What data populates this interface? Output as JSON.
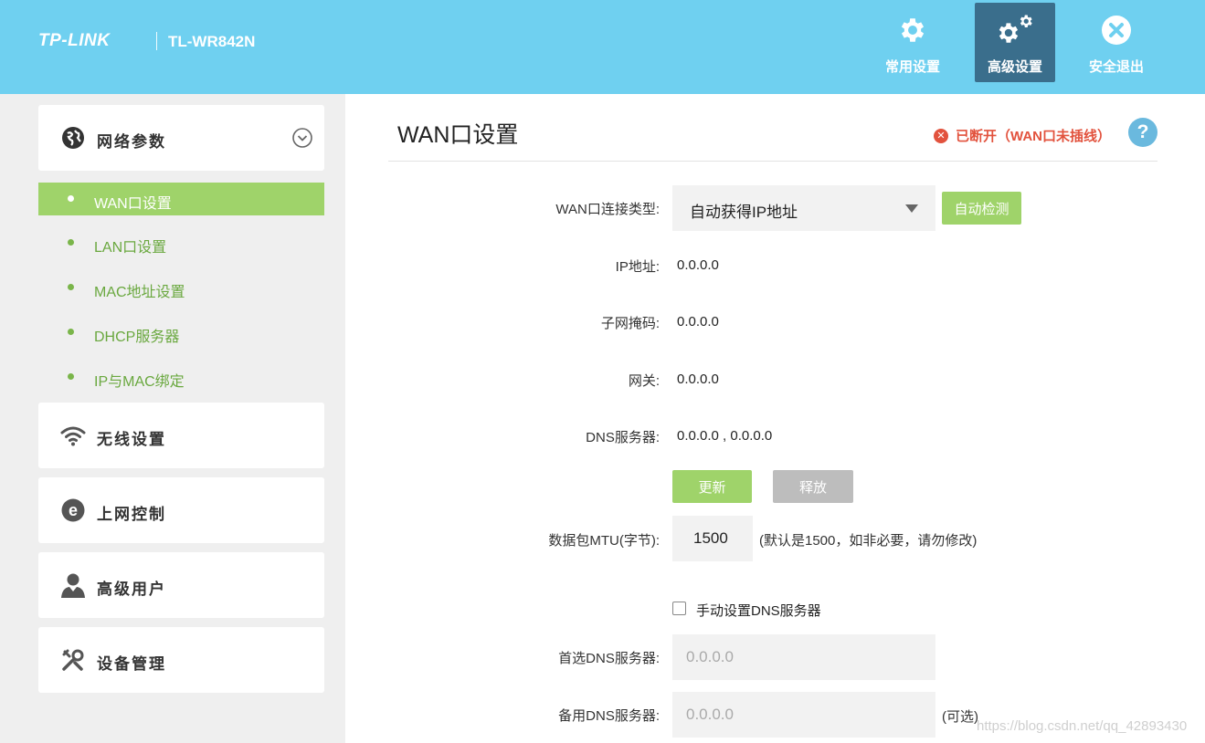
{
  "header": {
    "brand": "TP-LINK",
    "model": "TL-WR842N",
    "nav": [
      {
        "label": "常用设置",
        "icon": "gear-icon",
        "active": false
      },
      {
        "label": "高级设置",
        "icon": "gears-icon",
        "active": true
      },
      {
        "label": "安全退出",
        "icon": "close-icon",
        "active": false
      }
    ]
  },
  "sidebar": {
    "sections": [
      {
        "label": "网络参数",
        "icon": "globe-icon"
      },
      {
        "label": "无线设置",
        "icon": "wifi-icon"
      },
      {
        "label": "上网控制",
        "icon": "internet-e-icon"
      },
      {
        "label": "高级用户",
        "icon": "user-icon"
      },
      {
        "label": "设备管理",
        "icon": "tools-icon"
      }
    ],
    "subitems": [
      {
        "label": "WAN口设置",
        "active": true
      },
      {
        "label": "LAN口设置",
        "active": false
      },
      {
        "label": "MAC地址设置",
        "active": false
      },
      {
        "label": "DHCP服务器",
        "active": false
      },
      {
        "label": "IP与MAC绑定",
        "active": false
      }
    ]
  },
  "main": {
    "title": "WAN口设置",
    "status": "已断开（WAN口未插线）",
    "help": "?",
    "conn_type_label": "WAN口连接类型:",
    "conn_type_value": "自动获得IP地址",
    "auto_detect": "自动检测",
    "ip_label": "IP地址:",
    "ip_value": "0.0.0.0",
    "mask_label": "子网掩码:",
    "mask_value": "0.0.0.0",
    "gateway_label": "网关:",
    "gateway_value": "0.0.0.0",
    "dns_label": "DNS服务器:",
    "dns_value": "0.0.0.0 , 0.0.0.0",
    "renew": "更新",
    "release": "释放",
    "mtu_label": "数据包MTU(字节):",
    "mtu_value": "1500",
    "mtu_note": "(默认是1500，如非必要，请勿修改)",
    "manual_dns_label": "手动设置DNS服务器",
    "manual_dns_checked": false,
    "primary_dns_label": "首选DNS服务器:",
    "primary_dns_placeholder": "0.0.0.0",
    "secondary_dns_label": "备用DNS服务器:",
    "secondary_dns_placeholder": "0.0.0.0",
    "optional_note": "(可选)"
  },
  "watermark": "https://blog.csdn.net/qq_42893430",
  "colors": {
    "header": "#6fd0f0",
    "active_nav": "#3a6e8c",
    "green": "#9fd36a",
    "status_red": "#e2523d"
  }
}
